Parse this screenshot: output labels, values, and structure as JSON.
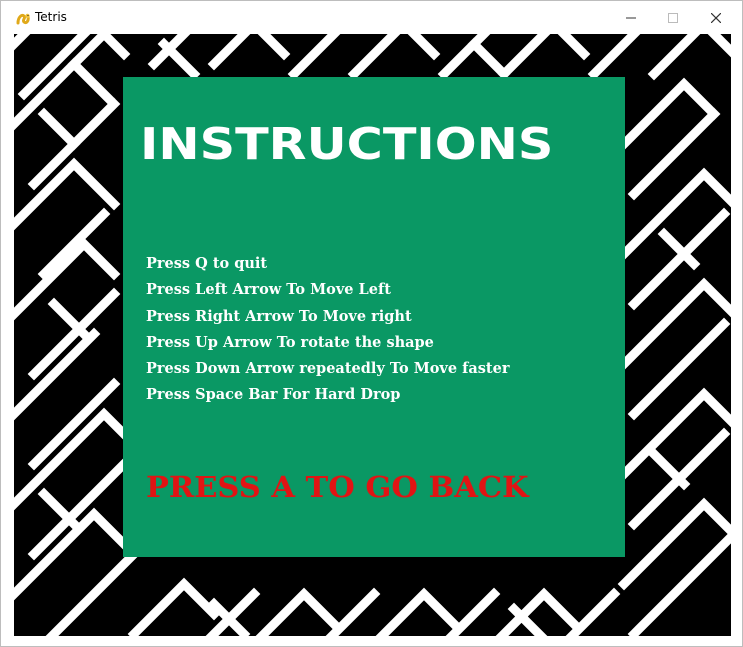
{
  "window": {
    "title": "Tetris",
    "app_icon": "pygame-snake-icon",
    "controls": [
      "minimize-icon",
      "maximize-icon",
      "close-icon"
    ]
  },
  "screen": {
    "background": "black-white-maze-pattern",
    "panel_color": "#0a9864",
    "heading": "INSTRUCTIONS",
    "instructions": [
      "Press Q to quit",
      "Press Left Arrow To Move Left",
      "Press Right Arrow To Move right",
      "Press Up Arrow To rotate the shape",
      "Press Down Arrow repeatedly To Move faster",
      "Press Space Bar For Hard Drop"
    ],
    "back_prompt": "PRESS A TO GO BACK",
    "back_prompt_color": "#e11414"
  }
}
